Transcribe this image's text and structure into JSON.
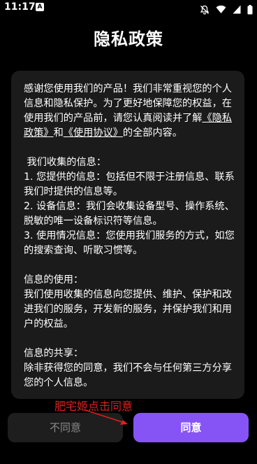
{
  "status_bar": {
    "time": "11:17",
    "notification_badge": "A",
    "icons": [
      "mute-bell-icon",
      "wifi-icon",
      "signal-icon",
      "battery-icon"
    ]
  },
  "title": "隐私政策",
  "policy": {
    "intro_prefix": "感谢您使用我们的产品！我们非常重视您的个人信息和隐私保护。为了更好地保障您的权益，在使用我们的产品前，请您认真阅读并了解",
    "link_privacy": "《隐私政策》",
    "and": "和",
    "link_terms": "《使用协议》",
    "intro_suffix": "的全部内容。",
    "collect_heading": " 我们收集的信息：",
    "collect_1": "1. 您提供的信息：包括但不限于注册信息、联系我们时提供的信息等。",
    "collect_2": "2. 设备信息：我们会收集设备型号、操作系统、脱敏的唯一设备标识符等信息。",
    "collect_3": "3. 使用情况信息：您使用我们服务的方式，如您的搜索查询、听歌习惯等。",
    "use_heading": "信息的使用：",
    "use_body": "我们使用收集的信息向您提供、维护、保护和改进我们的服务，开发新的服务，并保护我们和用户的权益。",
    "share_heading": "信息的共享：",
    "share_body": "除非获得您的同意，我们不会与任何第三方分享您的个人信息。"
  },
  "buttons": {
    "disagree": "不同意",
    "agree": "同意"
  },
  "annotation": "肥宅姬点击同意",
  "colors": {
    "background": "#000000",
    "card": "#1b1b1b",
    "accent": "#8654f5",
    "annotation": "#e0201f"
  }
}
